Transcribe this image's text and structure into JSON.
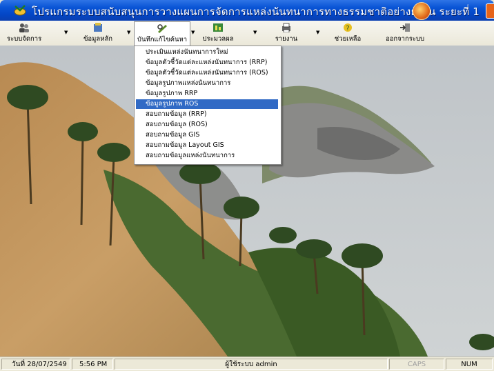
{
  "window": {
    "title": "โปรแกรมระบบสนับสนุนการวางแผนการจัดการแหล่งนันทนาการทางธรรมชาติอย่างยั่งยืน ระยะที่ 1"
  },
  "toolbar": {
    "items": [
      {
        "label": "ระบบจัดการ",
        "icon": "people-icon"
      },
      {
        "label": "ข้อมูลหลัก",
        "icon": "database-icon"
      },
      {
        "label": "บันทึกแก้ไขค้นหา",
        "icon": "edit-search-icon"
      },
      {
        "label": "ประมวลผล",
        "icon": "process-icon"
      },
      {
        "label": "รายงาน",
        "icon": "printer-icon"
      },
      {
        "label": "ช่วยเหลือ",
        "icon": "help-icon"
      },
      {
        "label": "ออกจากระบบ",
        "icon": "exit-icon"
      }
    ]
  },
  "dropdown": {
    "items": [
      "ประเมินแหล่งนันทนาการใหม่",
      "ข้อมูลตัวชี้วัดแต่ละแหล่งนันทนาการ (RRP)",
      "ข้อมูลตัวชี้วัดแต่ละแหล่งนันทนาการ (ROS)",
      "ข้อมูลรูปภาพแหล่งนันทนาการ",
      "ข้อมูลรูปภาพ RRP",
      "ข้อมูลรูปภาพ ROS",
      "สอบถามข้อมูล (RRP)",
      "สอบถามข้อมูล (ROS)",
      "สอบถามข้อมูล GIS",
      "สอบถามข้อมูล Layout GIS",
      "สอบถามข้อมูลแหล่งนันทนาการ"
    ],
    "selected_index": 5
  },
  "statusbar": {
    "date": "วันที่ 28/07/2549",
    "time": "5:56 PM",
    "user": "ผู้ใช้ระบบ admin",
    "caps": "CAPS",
    "num": "NUM"
  },
  "colors": {
    "titlebar": "#0a55d6",
    "selection": "#316ac5",
    "sea": "#c3c8cb",
    "hill": "#c9a068"
  }
}
